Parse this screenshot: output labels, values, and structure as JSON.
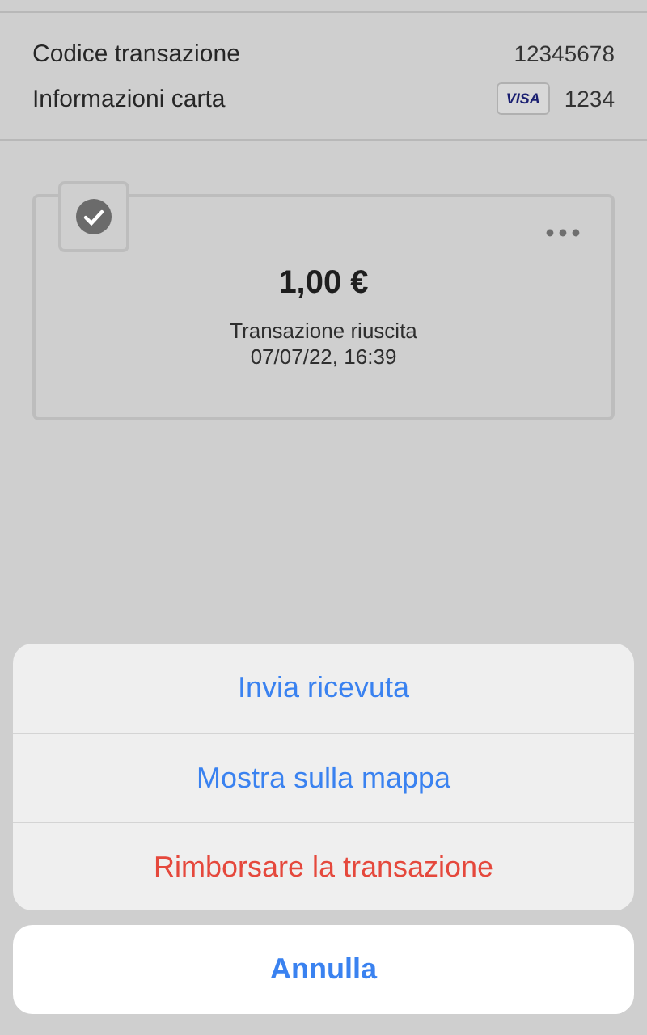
{
  "details": [
    {
      "label": "Codice transazione",
      "value": "12345678"
    },
    {
      "label": "Informazioni carta",
      "card_brand": "VISA",
      "value": "1234"
    }
  ],
  "transaction": {
    "succeeded": true,
    "amount": "1,00 €",
    "status_text": "Transazione riuscita",
    "date": "07/07/22, 16:39"
  },
  "action_sheet": {
    "actions": [
      {
        "label": "Invia ricevuta",
        "kind": "default"
      },
      {
        "label": "Mostra sulla mappa",
        "kind": "default"
      },
      {
        "label": "Rimborsare la transazione",
        "kind": "destructive"
      }
    ],
    "cancel": "Annulla"
  }
}
